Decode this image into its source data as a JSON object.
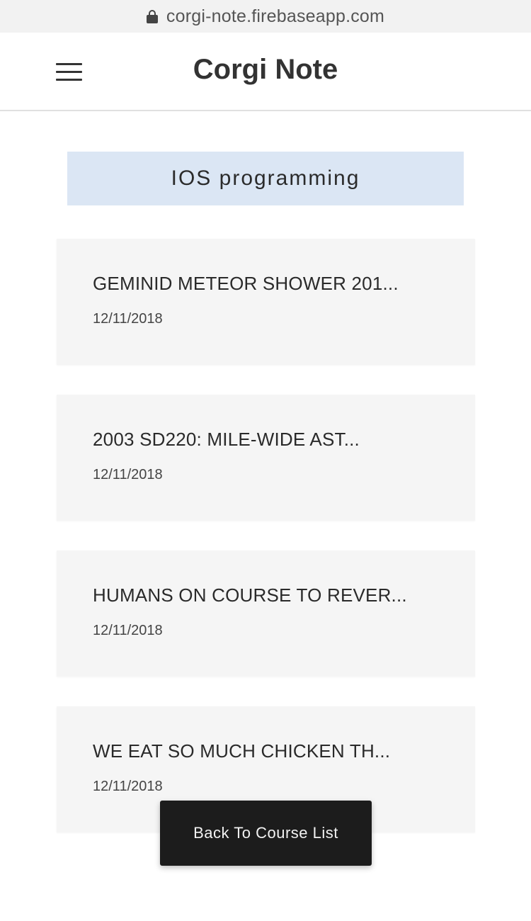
{
  "browser": {
    "url": "corgi-note.firebaseapp.com",
    "lock_icon": "lock-icon"
  },
  "header": {
    "menu_icon": "hamburger-menu-icon",
    "title": "Corgi Note"
  },
  "course": {
    "name": "IOS programming"
  },
  "notes": [
    {
      "title": "GEMINID METEOR SHOWER 201...",
      "date": "12/11/2018"
    },
    {
      "title": "2003 SD220: MILE-WIDE AST...",
      "date": "12/11/2018"
    },
    {
      "title": "HUMANS ON COURSE TO REVER...",
      "date": "12/11/2018"
    },
    {
      "title": "WE EAT SO MUCH CHICKEN TH...",
      "date": "12/11/2018"
    }
  ],
  "actions": {
    "back_label": "Back To Course List"
  },
  "colors": {
    "banner_bg": "#dbe6f4",
    "card_bg": "#f5f5f5",
    "button_bg": "#1c1c1c"
  }
}
